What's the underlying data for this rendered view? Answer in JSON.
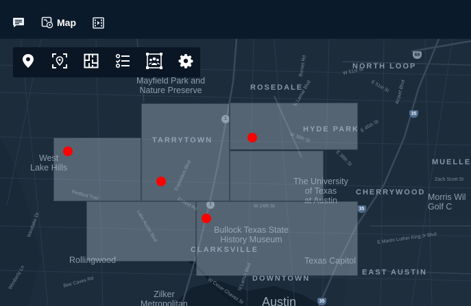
{
  "topbar": {
    "map_label": "Map"
  },
  "map": {
    "area_labels": {
      "north_loop": "NORTH LOOP",
      "rosedale": "ROSEDALE",
      "hyde_park": "HYDE PARK",
      "tarrytown": "TARRYTOWN",
      "cherrywood": "CHERRYWOOD",
      "mueller": "MUELLE",
      "clarksville": "CLARKSVILLE",
      "east_austin": "EAST AUSTIN",
      "downtown": "DOWNTOWN"
    },
    "place_labels": {
      "mayfield": "Mayfield Park and\nNature Preserve",
      "west_lake_hills": "West\nLake Hills",
      "ut_austin": "The University\nof Texas\nat Austin",
      "bullock": "Bullock Texas State\nHistory Museum",
      "texas_capitol": "Texas Capitol",
      "morris": "Morris Wil\nGolf C",
      "rollingwood": "Rollingwood",
      "zilker": "Zilker\nMetropolitan",
      "austin": "Austin"
    },
    "street_labels": {
      "w51st": "W 51st St",
      "e51st": "E 51st St",
      "airport": "Airport Blvd",
      "burnet": "Burnet Rd",
      "lamar": "N Lamar Blvd",
      "e45th": "E 45th St",
      "w38th": "W 38th St",
      "e38th": "E 38th St",
      "zach": "Zach Scott St",
      "redbud": "Redbud Trail",
      "expo": "Exposition Blvd",
      "enfield": "Enfield Rd",
      "lake_austin": "Lake Austin Blvd",
      "w24th": "W 24th St",
      "mlk": "E Martin Luther King Jr Blvd",
      "wm_cannon": "W Cesar Chavez St",
      "westlake": "Westlake Dr",
      "wimberly": "Wimberly Ln",
      "bee_caves": "Bee Caves Rd",
      "n_lamar2": "N Lamar Blvd"
    },
    "shields": {
      "loop1_a": "1",
      "loop1_b": "1",
      "i35_a": "35",
      "i35_b": "35",
      "i35_c": "35",
      "r69": "69"
    }
  },
  "colors": {
    "topbar_bg": "#0b1a2a",
    "map_bg": "#1d2c3b",
    "marker": "#ff0000",
    "region_fill": "rgba(165,178,192,0.42)"
  },
  "icons": {
    "topbar": [
      "chat-icon",
      "map-settings-icon",
      "video-timeline-icon"
    ],
    "toolbar": [
      "location-pin-icon",
      "pin-in-frame-icon",
      "floor-plan-icon",
      "checklist-icon",
      "group-frame-icon",
      "gear-icon"
    ]
  }
}
